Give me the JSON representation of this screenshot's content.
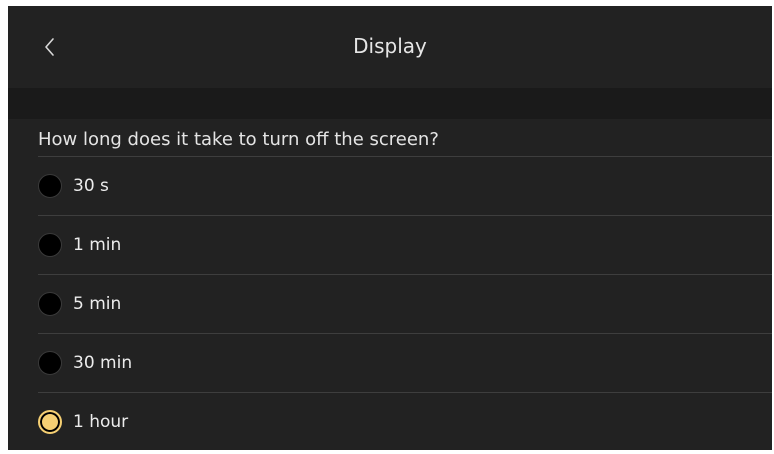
{
  "header": {
    "title": "Display",
    "back_icon": "chevron-left-icon"
  },
  "question": "How long does it take to turn off the screen?",
  "options": [
    {
      "label": "30 s",
      "selected": false
    },
    {
      "label": "1 min",
      "selected": false
    },
    {
      "label": "5 min",
      "selected": false
    },
    {
      "label": "30 min",
      "selected": false
    },
    {
      "label": "1 hour",
      "selected": true
    }
  ],
  "colors": {
    "background": "#222222",
    "band": "#1a1a1a",
    "accent": "#f5cf73",
    "divider": "#3e3e3e"
  }
}
